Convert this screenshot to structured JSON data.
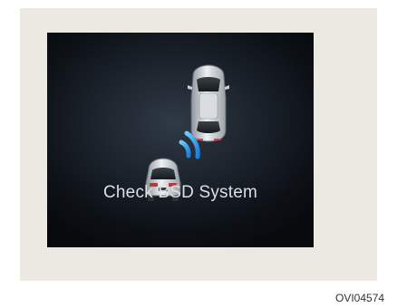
{
  "display": {
    "message": "Check BSD System"
  },
  "figure_code": "OVI04574"
}
